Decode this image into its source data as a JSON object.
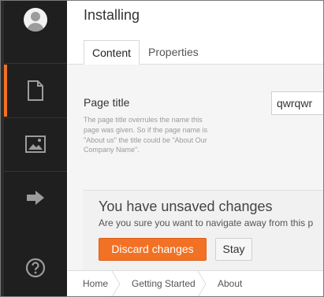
{
  "sidebar": {
    "items": [
      {
        "icon": "document-icon",
        "active": true
      },
      {
        "icon": "image-icon",
        "active": false
      },
      {
        "icon": "arrow-right-icon",
        "active": false
      },
      {
        "icon": "help-icon",
        "active": false
      }
    ]
  },
  "header": {
    "title": "Installing",
    "tabs": [
      {
        "label": "Content",
        "active": true
      },
      {
        "label": "Properties",
        "active": false
      }
    ]
  },
  "property": {
    "label": "Page title",
    "description": "The page title overrules the name this page was given. So if the page name is \"About us\" the title could be \"About Our Company Name\".",
    "value": "qwrqwr"
  },
  "dialog": {
    "title": "You have unsaved changes",
    "message": "Are you sure you want to navigate away from this p",
    "discard_label": "Discard changes",
    "stay_label": "Stay"
  },
  "breadcrumb": [
    "Home",
    "Getting Started",
    "About"
  ],
  "colors": {
    "accent": "#f27125",
    "sidebar": "#1f1f1f"
  }
}
